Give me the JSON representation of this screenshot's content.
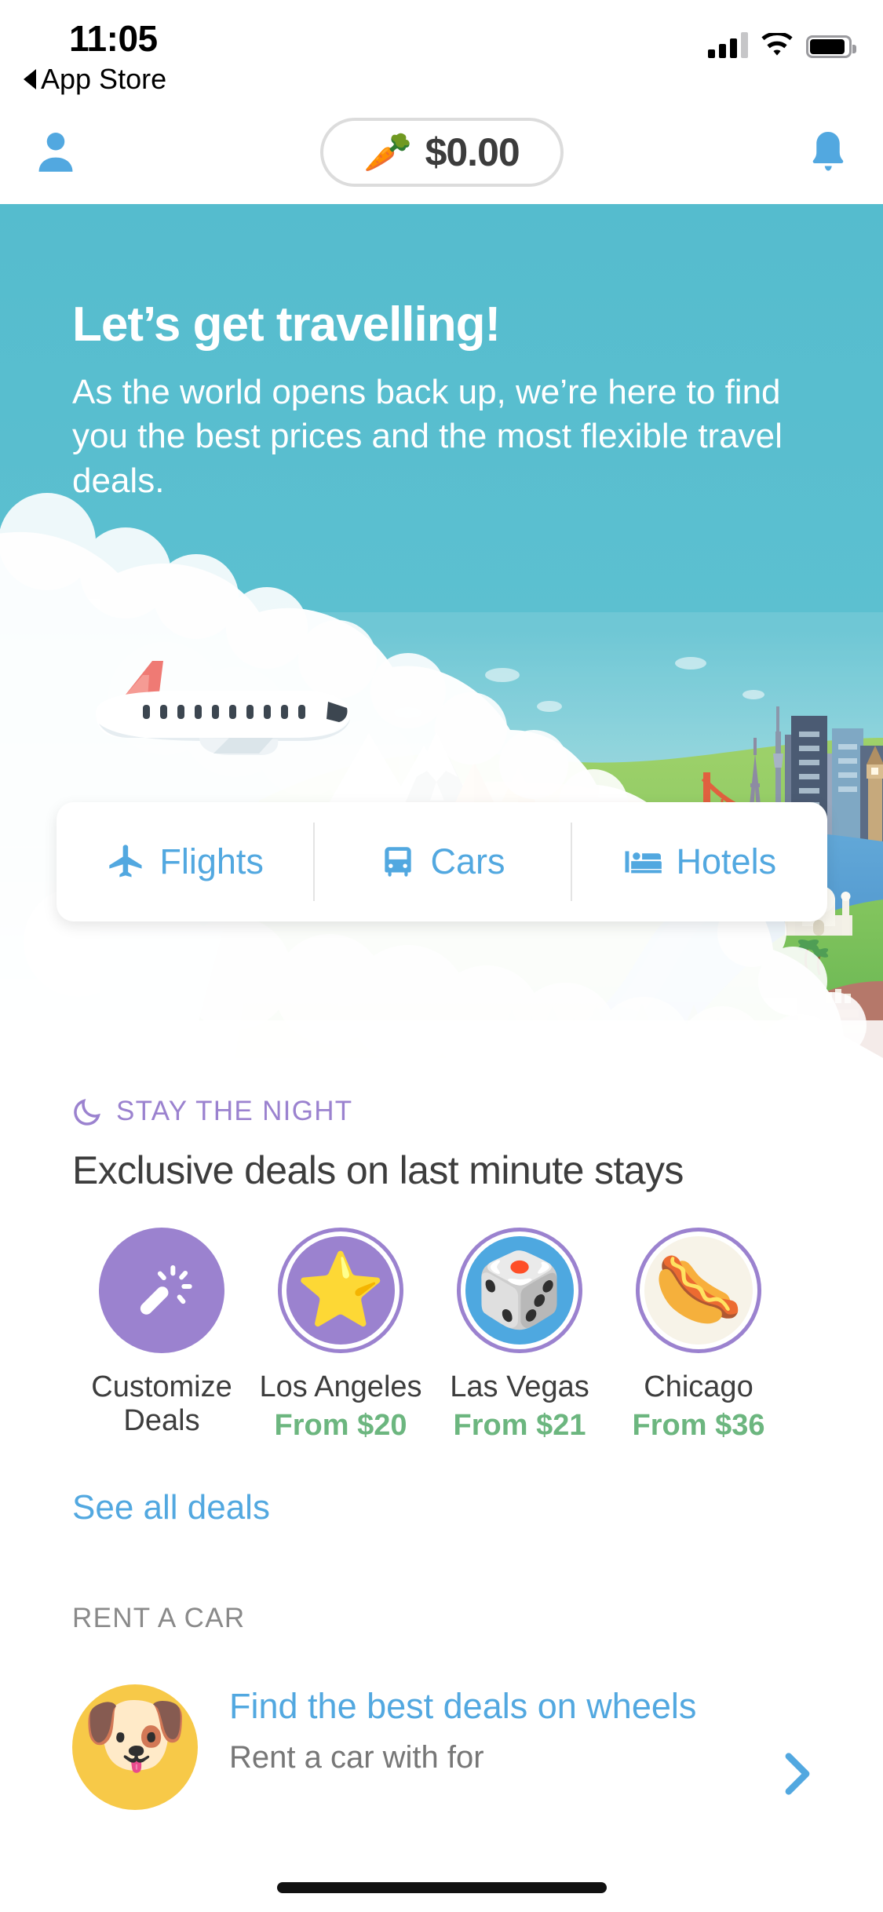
{
  "status_bar": {
    "time": "11:05",
    "back_label": "App Store",
    "signal_bars_filled": 3,
    "signal_bars_total": 4,
    "wifi": "wifi-full",
    "battery_level_pct": 92
  },
  "header": {
    "profile_icon": "person-icon",
    "notification_icon": "bell-icon",
    "balance_icon": "carrot-emoji",
    "balance_emoji": "🥕",
    "balance_amount": "$0.00",
    "accent_blue": "#52a8e0"
  },
  "hero": {
    "title": "Let’s get travelling!",
    "subtitle": "As the world opens back up, we’re here to find you the best prices and the most flexible travel deals.",
    "background_color": "#55bcce",
    "tabs": [
      {
        "label": "Flights",
        "icon": "airplane-icon"
      },
      {
        "label": "Cars",
        "icon": "car-icon"
      },
      {
        "label": "Hotels",
        "icon": "bed-icon"
      }
    ]
  },
  "stay_section": {
    "eyebrow": "STAY THE NIGHT",
    "eyebrow_icon": "moon-icon",
    "eyebrow_color": "#9b82cf",
    "title": "Exclusive deals on last minute stays",
    "see_all_label": "See all deals",
    "deals": [
      {
        "label": "Customize Deals",
        "price": "",
        "icon": "magic-wand-icon",
        "emoji": "",
        "style": "plain",
        "bg": "#9b82cf"
      },
      {
        "label": "Los Angeles",
        "price": "From $20",
        "icon": "star-emoji",
        "emoji": "⭐",
        "style": "ringed",
        "bg": "#9b82cf"
      },
      {
        "label": "Las Vegas",
        "price": "From $21",
        "icon": "dice-emoji",
        "emoji": "🎲",
        "style": "ringed",
        "bg": "#4ea8e0"
      },
      {
        "label": "Chicago",
        "price": "From $36",
        "icon": "hotdog-emoji",
        "emoji": "🌭",
        "style": "ringed",
        "bg": "#f7f3e8"
      }
    ],
    "price_color": "#6cb67f"
  },
  "car_section": {
    "kicker": "RENT A CAR",
    "title": "Find the best deals on wheels",
    "subtitle": "Rent a car with for",
    "avatar_emoji": "🐶",
    "avatar_icon": "dog-emoji",
    "avatar_bg": "#f7c948",
    "chevron_icon": "chevron-right-icon"
  }
}
